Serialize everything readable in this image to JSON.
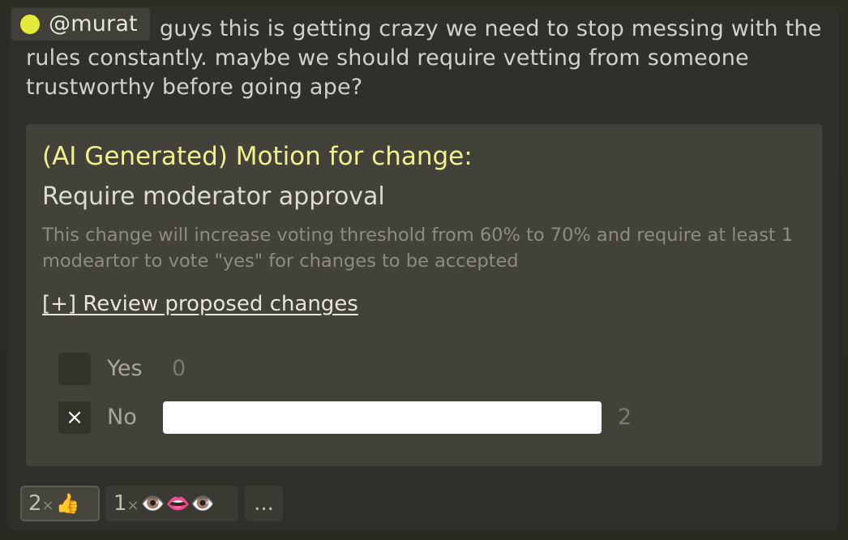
{
  "message": {
    "author": "@murat",
    "avatar_color": "#e4ea3c",
    "text": "guys this is getting crazy we need to stop messing with the rules constantly. maybe we should require vetting from someone trustworthy before going ape?"
  },
  "motion": {
    "heading": "(AI Generated) Motion for change:",
    "title": "Require moderator approval",
    "description": "This change will increase voting threshold from 60% to 70% and require at least 1 modeartor to vote \"yes\" for changes to be accepted",
    "review_link": "[+] Review proposed changes",
    "options": [
      {
        "label": "Yes",
        "count": "0",
        "checked": false,
        "share": 0
      },
      {
        "label": "No",
        "count": "2",
        "checked": true,
        "check_mark": "×",
        "share": 1.0
      }
    ]
  },
  "reactions": [
    {
      "count": "2",
      "times": "×",
      "emoji": "👍",
      "active": true
    },
    {
      "count": "1",
      "times": "×",
      "emoji": "👁️👄👁️",
      "active": false
    }
  ],
  "more_label": "...",
  "colors": {
    "heading": "#f0f08c",
    "bar_fill": "#ffffff",
    "card_bg": "#42423a"
  }
}
